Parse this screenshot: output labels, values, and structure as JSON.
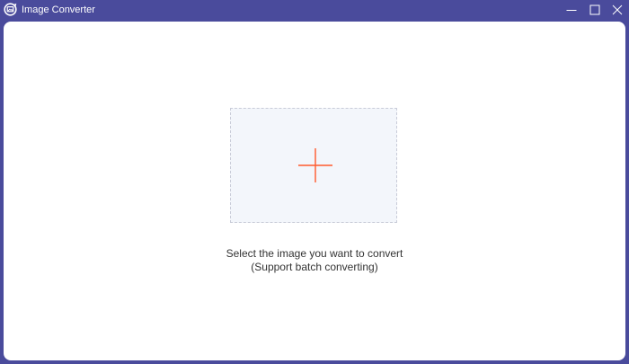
{
  "window": {
    "title": "Image Converter",
    "controls": {
      "minimize": "minimize-icon",
      "maximize": "maximize-icon",
      "close": "close-icon"
    }
  },
  "main": {
    "drop_zone_icon": "plus-icon",
    "hint_line1": "Select the image you want to convert",
    "hint_line2": "(Support batch converting)"
  },
  "colors": {
    "titlebar": "#4a4b9c",
    "accent": "#ff5a2c",
    "drop_zone_bg": "#f3f6fb"
  }
}
